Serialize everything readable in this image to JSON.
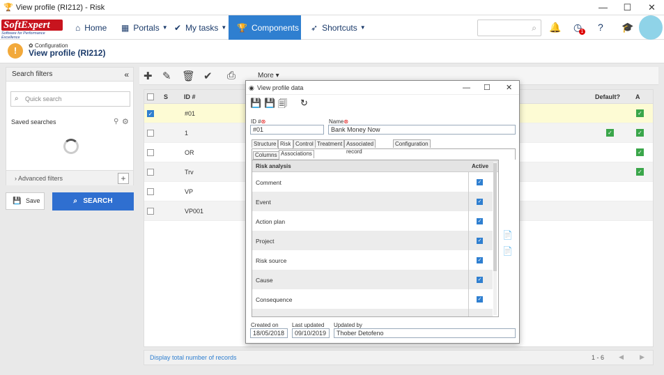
{
  "window": {
    "title": "View profile (RI212) - Risk",
    "controls": {
      "minimize": "—",
      "maximize": "☐",
      "close": "✕"
    }
  },
  "nav": {
    "logo_text": "SoftExpert",
    "logo_tagline": "Software for Performance Excellence",
    "items": [
      {
        "label": "Home",
        "icon": "home-icon"
      },
      {
        "label": "Portals",
        "icon": "grid-icon"
      },
      {
        "label": "My tasks",
        "icon": "check-icon"
      },
      {
        "label": "Components",
        "icon": "trophy-icon"
      },
      {
        "label": "Shortcuts",
        "icon": "rocket-icon"
      }
    ],
    "active_item": "Components",
    "notification_count": "1"
  },
  "header": {
    "breadcrumb": "Configuration",
    "title": "View profile (RI212)"
  },
  "filters": {
    "title": "Search filters",
    "quick_search_placeholder": "Quick search",
    "saved_searches": "Saved searches",
    "advanced_filters": "Advanced filters",
    "save_label": "Save",
    "search_label": "SEARCH"
  },
  "toolbar": {
    "more_label": "More"
  },
  "grid": {
    "columns": [
      "S",
      "ID #",
      "Default?",
      "A"
    ],
    "rows": [
      {
        "id": "#01",
        "checked": true,
        "default": false,
        "active": true
      },
      {
        "id": "1",
        "checked": false,
        "default": true,
        "active": true
      },
      {
        "id": "OR",
        "checked": false,
        "default": false,
        "active": true
      },
      {
        "id": "Trv",
        "checked": false,
        "default": false,
        "active": true
      },
      {
        "id": "VP",
        "checked": false,
        "default": false,
        "active": false
      },
      {
        "id": "VP001",
        "checked": false,
        "default": false,
        "active": false
      }
    ],
    "footer_total": "Display total number of records",
    "range": "1 - 6"
  },
  "dialog": {
    "title": "View profile data",
    "id_label": "ID #",
    "id_value": "#01",
    "name_label": "Name",
    "name_value": "Bank Money Now",
    "tabs": [
      "Structure",
      "Risk",
      "Control",
      "Treatment",
      "Associated record",
      "Configuration"
    ],
    "active_tab": "Risk",
    "subtabs": [
      "Columns",
      "Associations"
    ],
    "active_subtab": "Associations",
    "table_headers": {
      "analysis": "Risk analysis",
      "active": "Active"
    },
    "rows": [
      "Comment",
      "Event",
      "Action plan",
      "Project",
      "Risk source",
      "Cause",
      "Consequence"
    ],
    "created_on_label": "Created on",
    "created_on": "18/05/2018",
    "last_updated_label": "Last updated",
    "last_updated": "09/10/2019",
    "updated_by_label": "Updated by",
    "updated_by": "Thober Detofeno"
  },
  "colors": {
    "accent": "#2f7fd0",
    "check_green": "#3aa64a",
    "selected_row": "#fdfbd4"
  }
}
